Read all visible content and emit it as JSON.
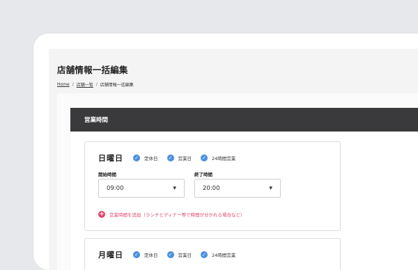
{
  "page": {
    "title": "店舗情報一括編集",
    "breadcrumb": [
      {
        "label": "Home"
      },
      {
        "label": "店舗一覧"
      },
      {
        "label": "店舗情報一括編集"
      }
    ],
    "breadcrumb_separator": "/"
  },
  "section": {
    "header": "営業時間"
  },
  "days": [
    {
      "name": "日曜日",
      "options": [
        "定休日",
        "営業日",
        "24時間営業"
      ],
      "start_label": "開始時間",
      "start_value": "09:00",
      "end_label": "終了時間",
      "end_value": "20:00",
      "add_label": "営業時間を追加（ランチとディナー等で時間が分かれる場合など）"
    },
    {
      "name": "月曜日",
      "options": [
        "定休日",
        "営業日",
        "24時間営業"
      ]
    }
  ],
  "colors": {
    "header_bg": "#3a3a3c",
    "check_blue": "#4a90e2",
    "add_pink": "#e0456b"
  },
  "icons": {
    "check": "check-circle-icon",
    "caret": "caret-down-icon",
    "add": "plus-circle-icon"
  }
}
